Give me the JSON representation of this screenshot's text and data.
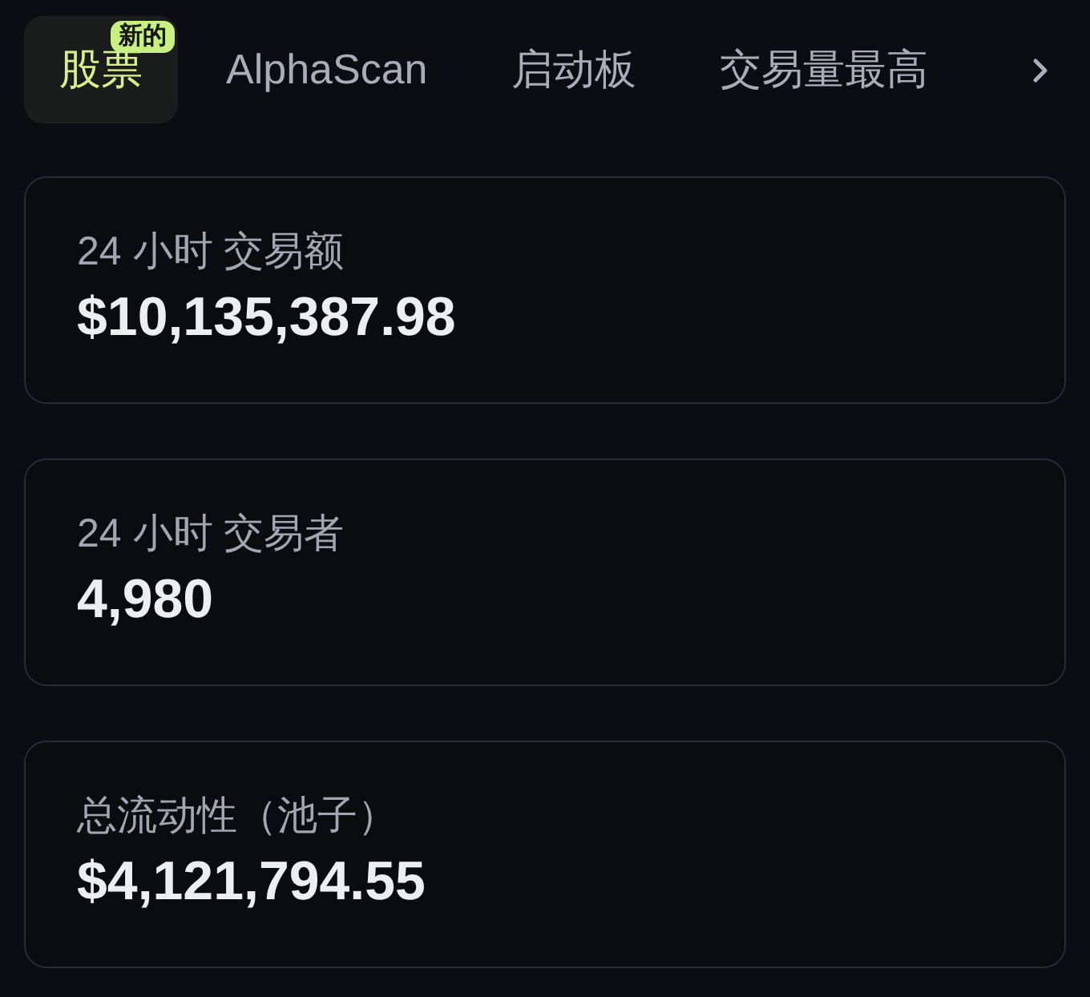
{
  "tabs": [
    {
      "label": "股票",
      "selected": true,
      "badge": "新的"
    },
    {
      "label": "AlphaScan",
      "selected": false
    },
    {
      "label": "启动板",
      "selected": false
    },
    {
      "label": "交易量最高",
      "selected": false
    }
  ],
  "stats": [
    {
      "label": "24 小时 交易额",
      "value": "$10,135,387.98"
    },
    {
      "label": "24 小时 交易者",
      "value": "4,980"
    },
    {
      "label": "总流动性（池子）",
      "value": "$4,121,794.55"
    }
  ]
}
